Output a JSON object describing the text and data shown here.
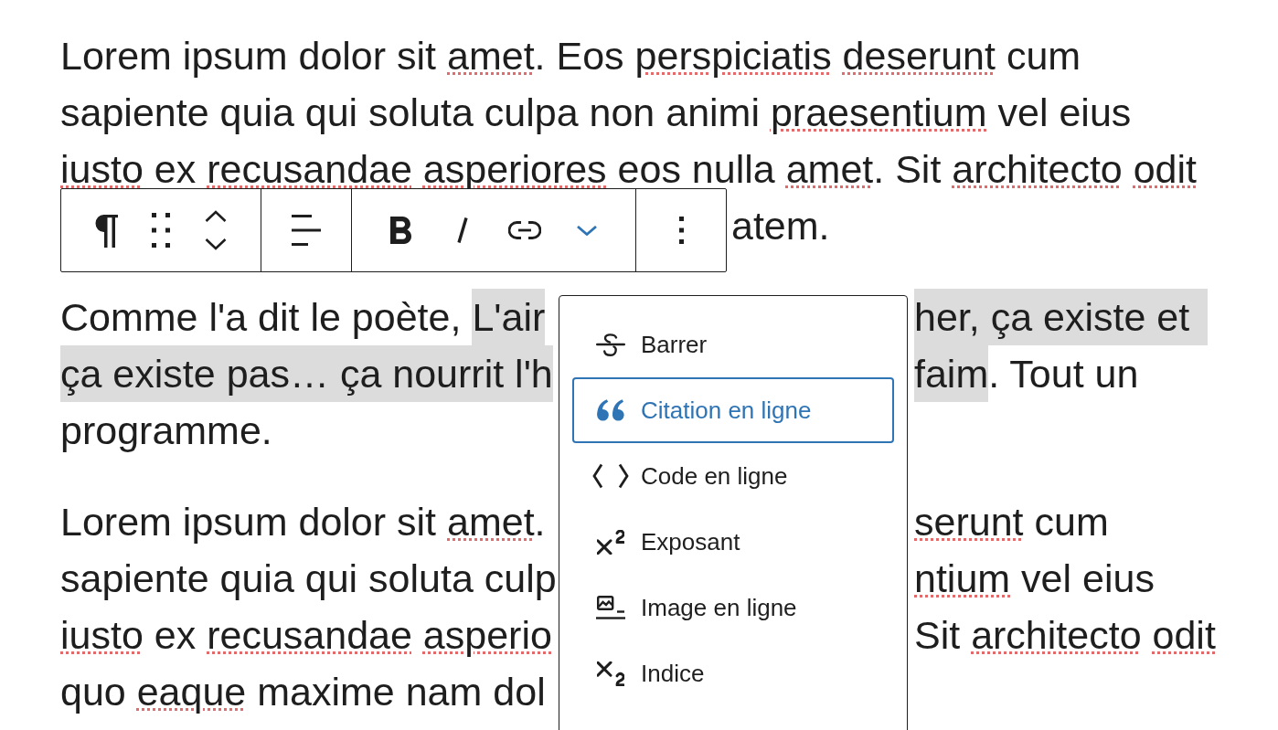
{
  "paragraphs": [
    {
      "lines": [
        {
          "kind": "full",
          "segments": [
            {
              "text": "Lorem ipsum dolor sit ",
              "misspelled": false,
              "selected": false
            },
            {
              "text": "amet",
              "misspelled": true,
              "selected": false
            },
            {
              "text": ". Eos ",
              "misspelled": false,
              "selected": false
            },
            {
              "text": "perspiciatis",
              "misspelled": true,
              "selected": false
            },
            {
              "text": " deserunt",
              "misspelled": true,
              "selected": false
            },
            {
              "text": " cum",
              "misspelled": false,
              "selected": false
            }
          ]
        },
        {
          "kind": "full",
          "segments": [
            {
              "text": "sapiente quia qui soluta culpa non animi ",
              "misspelled": false,
              "selected": false
            },
            {
              "text": "praesentium",
              "misspelled": true,
              "selected": false
            },
            {
              "text": " vel eius",
              "misspelled": false,
              "selected": false
            }
          ]
        },
        {
          "kind": "full",
          "segments": [
            {
              "text": "iusto",
              "misspelled": true,
              "selected": false
            },
            {
              "text": " ex ",
              "misspelled": false,
              "selected": false
            },
            {
              "text": "recusandae",
              "misspelled": true,
              "selected": false
            },
            {
              "text": " asperiores",
              "misspelled": true,
              "selected": false
            },
            {
              "text": " eos nulla ",
              "misspelled": false,
              "selected": false
            },
            {
              "text": "amet",
              "misspelled": true,
              "selected": false
            },
            {
              "text": ". Sit ",
              "misspelled": false,
              "selected": false
            },
            {
              "text": "architecto",
              "misspelled": true,
              "selected": false
            },
            {
              "text": " odit",
              "misspelled": true,
              "selected": false
            }
          ]
        },
        {
          "kind": "toolbar",
          "after": [
            {
              "text": "atem.",
              "misspelled": false,
              "selected": false
            }
          ]
        }
      ]
    },
    {
      "lines": [
        {
          "kind": "menu",
          "before": [
            {
              "text": "Comme l'a dit le poète, ",
              "misspelled": false,
              "selected": false
            },
            {
              "text": "L'air",
              "misspelled": false,
              "selected": true
            }
          ],
          "after": [
            {
              "text": "her, ça existe et",
              "misspelled": false,
              "selected": true
            }
          ]
        },
        {
          "kind": "menu",
          "before": [
            {
              "text": "ça existe pas… ça nourrit l'h",
              "misspelled": false,
              "selected": true
            }
          ],
          "after": [
            {
              "text": "faim",
              "misspelled": false,
              "selected": true
            },
            {
              "text": ". Tout un",
              "misspelled": false,
              "selected": false
            }
          ]
        },
        {
          "kind": "full",
          "segments": [
            {
              "text": "programme.",
              "misspelled": false,
              "selected": false
            }
          ]
        }
      ]
    },
    {
      "lines": [
        {
          "kind": "menu",
          "before": [
            {
              "text": "Lorem ipsum dolor sit ",
              "misspelled": false,
              "selected": false
            },
            {
              "text": "amet",
              "misspelled": true,
              "selected": false
            },
            {
              "text": ".",
              "misspelled": false,
              "selected": false
            }
          ],
          "after": [
            {
              "text": "serunt",
              "misspelled": true,
              "selected": false
            },
            {
              "text": " cum",
              "misspelled": false,
              "selected": false
            }
          ]
        },
        {
          "kind": "menu",
          "before": [
            {
              "text": "sapiente quia qui soluta culp",
              "misspelled": false,
              "selected": false
            }
          ],
          "after": [
            {
              "text": "ntium",
              "misspelled": true,
              "selected": false
            },
            {
              "text": " vel eius",
              "misspelled": false,
              "selected": false
            }
          ]
        },
        {
          "kind": "menu",
          "before": [
            {
              "text": "iusto",
              "misspelled": true,
              "selected": false
            },
            {
              "text": " ex ",
              "misspelled": false,
              "selected": false
            },
            {
              "text": "recusandae",
              "misspelled": true,
              "selected": false
            },
            {
              "text": " asperio",
              "misspelled": true,
              "selected": false
            }
          ],
          "after": [
            {
              "text": "Sit ",
              "misspelled": false,
              "selected": false
            },
            {
              "text": "architecto",
              "misspelled": true,
              "selected": false
            },
            {
              "text": " odit",
              "misspelled": true,
              "selected": false
            }
          ]
        },
        {
          "kind": "menu",
          "before": [
            {
              "text": "quo ",
              "misspelled": false,
              "selected": false
            },
            {
              "text": "eaque",
              "misspelled": true,
              "selected": false
            },
            {
              "text": " maxime nam dol",
              "misspelled": false,
              "selected": false
            }
          ]
        }
      ]
    }
  ],
  "block_toolbar": {
    "groups": [
      {
        "buttons": [
          {
            "kind": "block-type"
          },
          {
            "kind": "drag"
          },
          {
            "kind": "move"
          }
        ]
      },
      {
        "buttons": [
          {
            "kind": "align"
          }
        ]
      },
      {
        "buttons": [
          {
            "kind": "bold"
          },
          {
            "kind": "italic"
          },
          {
            "kind": "link"
          },
          {
            "kind": "more-formats",
            "expanded": true
          }
        ]
      },
      {
        "buttons": [
          {
            "kind": "options"
          }
        ]
      }
    ]
  },
  "format_menu": {
    "items": [
      {
        "kind": "strikethrough",
        "label": "Barrer",
        "selected": false
      },
      {
        "kind": "inline-quote",
        "label": "Citation en ligne",
        "selected": true
      },
      {
        "kind": "inline-code",
        "label": "Code en ligne",
        "selected": false
      },
      {
        "kind": "superscript",
        "label": "Exposant",
        "selected": false
      },
      {
        "kind": "inline-image",
        "label": "Image en ligne",
        "selected": false
      },
      {
        "kind": "subscript",
        "label": "Indice",
        "selected": false
      }
    ]
  }
}
